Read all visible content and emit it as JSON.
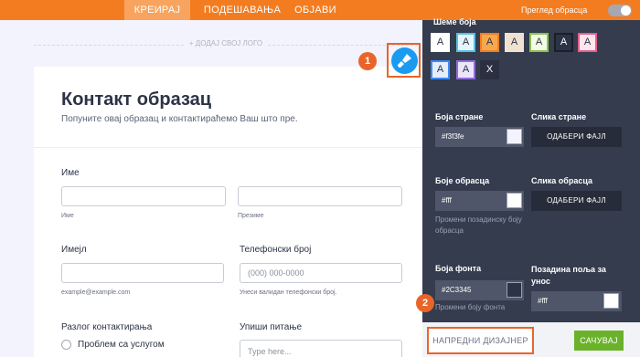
{
  "topbar": {
    "tabs": [
      {
        "label": "КРЕИРАЈ",
        "active": true
      },
      {
        "label": "ПОДЕШАВАЊА",
        "active": false
      },
      {
        "label": "ОБЈАВИ",
        "active": false
      }
    ],
    "preview_label": "Преглед обрасца",
    "preview_enabled": false,
    "bar_color": "#f47c20"
  },
  "canvas": {
    "add_logo": "+ ДОДАЈ СВОЈ ЛОГО",
    "background_color": "#f3f3fe"
  },
  "form": {
    "title": "Контакт образац",
    "subtitle": "Попуните овај образац и контактираћемо Ваш што пре.",
    "name_label": "Име",
    "first_name_hint": "Име",
    "last_name_hint": "Презиме",
    "email_label": "Имејл",
    "email_hint": "example@example.com",
    "phone_label": "Телефонски број",
    "phone_placeholder": "(000) 000-0000",
    "phone_hint": "Унеси валидан телефонски број.",
    "reason_label": "Разлог контактирања",
    "reason_options": [
      "Проблем са услугом"
    ],
    "question_label": "Упиши питање",
    "question_placeholder": "Type here..."
  },
  "annotations": {
    "badge_1": "1",
    "badge_2": "2",
    "accent": "#e8652a",
    "brush_icon": "paint-brush-icon"
  },
  "panel": {
    "schemes_label": "Шеме боја",
    "swatches": [
      {
        "letter": "A",
        "bg": "#ffffff",
        "fg": "#2c3345",
        "border": "#ffffff"
      },
      {
        "letter": "A",
        "bg": "#e6f4fb",
        "fg": "#2c3345",
        "border": "#5bc0de"
      },
      {
        "letter": "A",
        "bg": "#f7a84d",
        "fg": "#2c3345",
        "border": "#f47c20"
      },
      {
        "letter": "A",
        "bg": "#efe2d2",
        "fg": "#2c3345",
        "border": "#efe2d2"
      },
      {
        "letter": "A",
        "bg": "#f3fbe6",
        "fg": "#2c3345",
        "border": "#8bc34a"
      },
      {
        "letter": "A",
        "bg": "#2c3345",
        "fg": "#ffffff",
        "border": "#1b1f2a"
      },
      {
        "letter": "A",
        "bg": "#fde6ee",
        "fg": "#2c3345",
        "border": "#e85e8c"
      },
      {
        "letter": "A",
        "bg": "#e5eefc",
        "fg": "#2c3345",
        "border": "#3d8af7"
      },
      {
        "letter": "A",
        "bg": "#ece6fa",
        "fg": "#2c3345",
        "border": "#8e6ddb"
      },
      {
        "letter": "X",
        "bg": "#2a3040",
        "fg": "#ffffff",
        "border": "#2a3040"
      }
    ],
    "page_color_label": "Боја стране",
    "page_color_value": "#f3f3fe",
    "page_image_label": "Слика стране",
    "page_image_button": "ОДАБЕРИ ФАЈЛ",
    "form_color_label": "Боје обрасца",
    "form_color_value": "#fff",
    "form_color_hint": "Промени позадинску боју обрасца",
    "form_image_label": "Слика обрасца",
    "form_image_button": "ОДАБЕРИ ФАЈЛ",
    "font_color_label": "Боја фонта",
    "font_color_value": "#2C3345",
    "font_color_hint": "Промени боју фонта",
    "field_bg_label": "Позадина поља за унос",
    "field_bg_value": "#fff",
    "advanced_button": "НАПРЕДНИ ДИЗАЈНЕР",
    "save_button": "САЧУВАЈ",
    "save_color": "#6bb22b"
  }
}
